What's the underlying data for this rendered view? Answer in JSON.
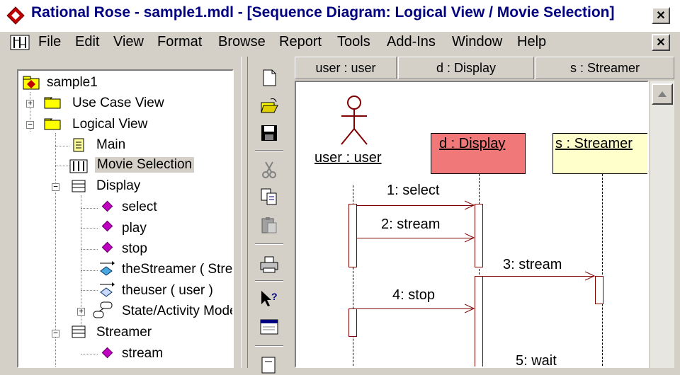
{
  "window": {
    "title": "Rational Rose - sample1.mdl - [Sequence Diagram: Logical View / Movie Selection]",
    "close_glyph": "✕"
  },
  "menu": {
    "items": [
      "File",
      "Edit",
      "View",
      "Format",
      "Browse",
      "Report",
      "Tools",
      "Add-Ins",
      "Window",
      "Help"
    ]
  },
  "tree": {
    "root": "sample1",
    "use_case_view": "Use Case View",
    "logical_view": "Logical View",
    "main": "Main",
    "movie_selection": "Movie Selection",
    "display": "Display",
    "display_ops": [
      "select",
      "play",
      "stop"
    ],
    "the_streamer": "theStreamer ( Streamer )",
    "the_user": "theuser ( user )",
    "state_activity": "State/Activity Model",
    "streamer": "Streamer",
    "streamer_ops": [
      "stream"
    ],
    "expander_plus": "+",
    "expander_minus": "−",
    "selected_color": "#d4d0c8"
  },
  "diagram": {
    "headers": [
      "user : user",
      "d : Display",
      "s : Streamer"
    ],
    "objects": {
      "user": "user : user",
      "display": "d : Display",
      "streamer": "s : Streamer"
    },
    "colors": {
      "display_fill": "#f07878",
      "streamer_fill": "#ffffcc",
      "message": "#800000",
      "actor": "#800000"
    },
    "messages": [
      "1: select",
      "2: stream",
      "3: stream",
      "4: stop",
      "5: wait"
    ]
  }
}
